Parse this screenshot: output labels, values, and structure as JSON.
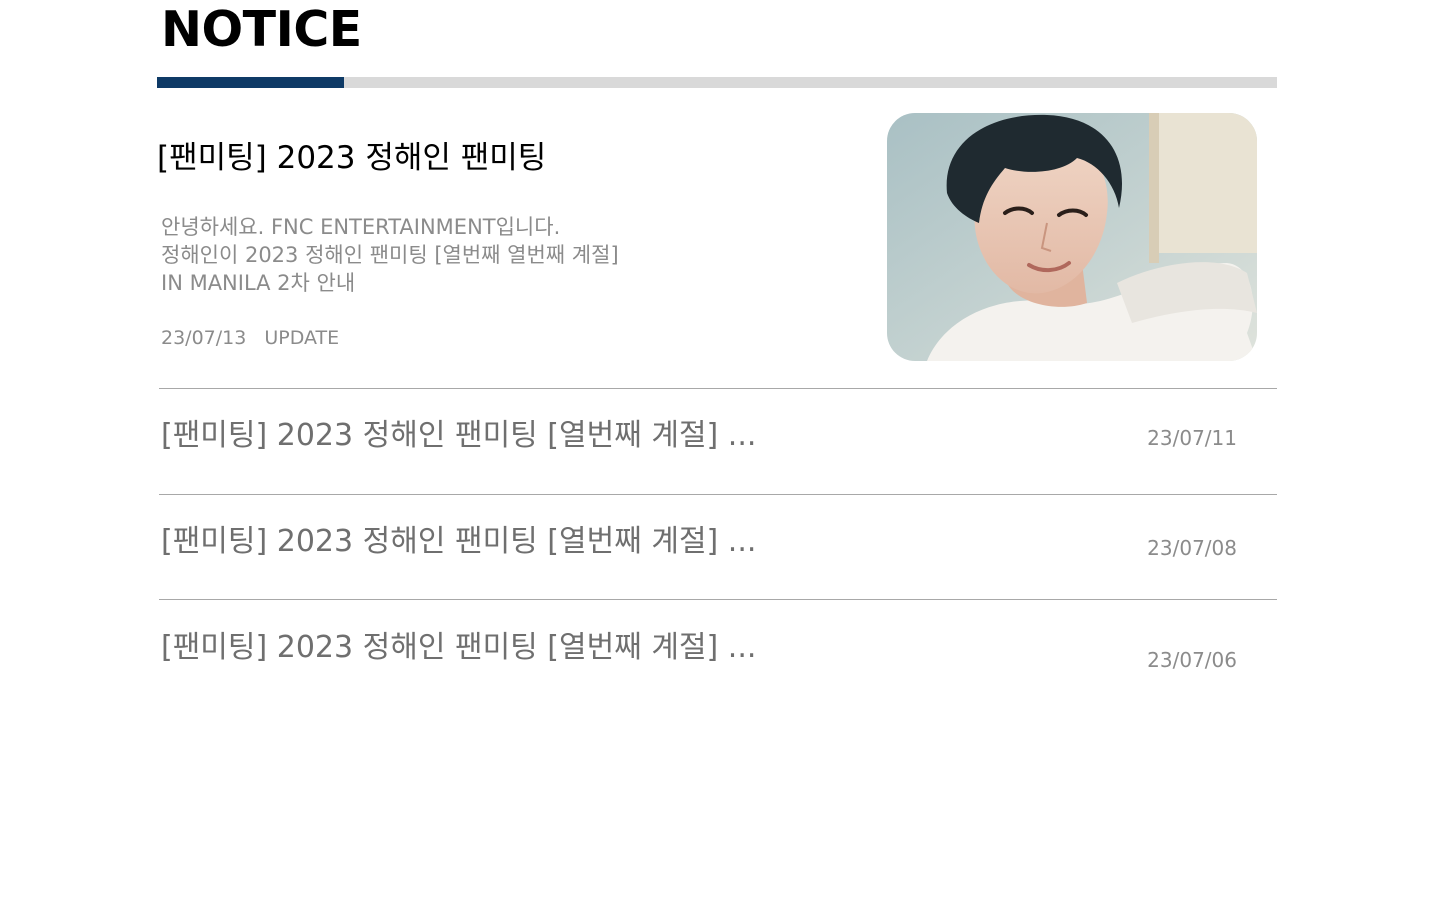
{
  "section": {
    "title": "NOTICE",
    "accent_color": "#0e3a66"
  },
  "featured": {
    "heading": "[팬미팅] 2023 정해인 팬미팅",
    "summary_lines": [
      "안녕하세요. FNC ENTERTAINMENT입니다.",
      "정해인이 2023 정해인 팬미팅 [열번째 열번째 계절]",
      "IN MANILA 2차 안내"
    ],
    "date": "23/07/13",
    "badge": "UPDATE",
    "image_icon": "portrait-photo"
  },
  "notices": [
    {
      "title": "[팬미팅] 2023 정해인 팬미팅 [열번째 계절] ...",
      "date": "23/07/11"
    },
    {
      "title": "[팬미팅] 2023 정해인 팬미팅 [열번째 계절] ...",
      "date": "23/07/08"
    },
    {
      "title": "[팬미팅] 2023 정해인 팬미팅 [열번째 계절] ...",
      "date": "23/07/06"
    }
  ]
}
